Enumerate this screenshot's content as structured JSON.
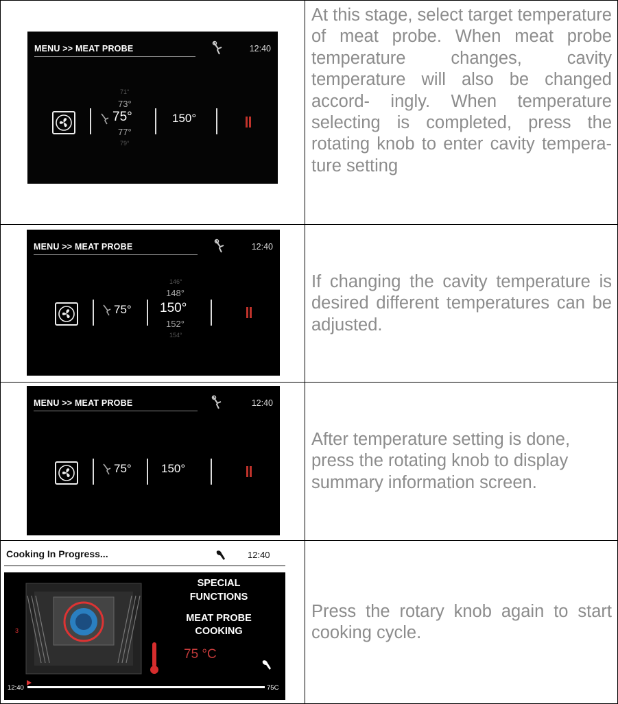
{
  "rows": [
    {
      "screen": {
        "header": "MENU >> MEAT PROBE",
        "time": "12:40",
        "probe_values": [
          "71°",
          "73°",
          "75°",
          "77°",
          "79°"
        ],
        "probe_selected": "75°",
        "cavity_values": [
          "150°"
        ],
        "cavity_selected": "150°"
      },
      "description": "At this stage, select target temperature of meat probe. When meat probe temperature changes, cavity temperature will also be changed accord- ingly. When temperature selecting is completed, press the rotating knob to enter cavity tempera- ture setting"
    },
    {
      "screen": {
        "header": "MENU >> MEAT PROBE",
        "time": "12:40",
        "probe_values": [
          "75°"
        ],
        "probe_selected": "75°",
        "cavity_values": [
          "146°",
          "148°",
          "150°",
          "152°",
          "154°"
        ],
        "cavity_selected": "150°"
      },
      "description": "If changing the cavity temperature is desired different temperatures can be adjusted."
    },
    {
      "screen": {
        "header": "MENU >> MEAT PROBE",
        "time": "12:40",
        "probe_values": [
          "75°"
        ],
        "probe_selected": "75°",
        "cavity_values": [
          "150°"
        ],
        "cavity_selected": "150°"
      },
      "description": "After temperature setting is done, press the rotating knob to display summary information screen."
    },
    {
      "screen": {
        "header": "Cooking In Progress...",
        "time": "12:40",
        "function_line1": "SPECIAL",
        "function_line2": "FUNCTIONS",
        "function_line3": "MEAT PROBE",
        "function_line4": "COOKING",
        "probe_reading": "75 °C",
        "progress_start": "12:40",
        "progress_end": "75C"
      },
      "description": "Press the rotary knob again to start cooking cycle."
    }
  ],
  "colors": {
    "text": "#8c8c8c",
    "screen_bg": "#000000",
    "accent_red": "#c0332b"
  }
}
